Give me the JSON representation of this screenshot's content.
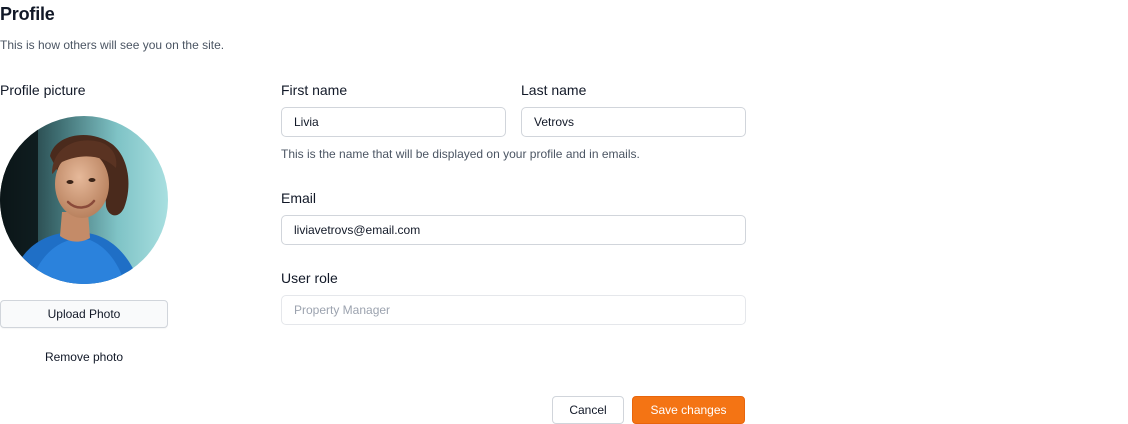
{
  "header": {
    "title": "Profile",
    "subtitle": "This is how others will see you on the site."
  },
  "profile_picture": {
    "label": "Profile picture",
    "upload_label": "Upload Photo",
    "remove_label": "Remove photo"
  },
  "form": {
    "first_name": {
      "label": "First name",
      "value": "Livia"
    },
    "last_name": {
      "label": "Last name",
      "value": "Vetrovs"
    },
    "name_helper": "This is the name that will be displayed on your profile and in emails.",
    "email": {
      "label": "Email",
      "value": "liviavetrovs@email.com"
    },
    "user_role": {
      "label": "User role",
      "placeholder": "Property Manager"
    }
  },
  "actions": {
    "cancel_label": "Cancel",
    "save_label": "Save changes"
  },
  "colors": {
    "accent": "#f47414",
    "border": "#d1d5db",
    "muted_text": "#4b5563"
  }
}
